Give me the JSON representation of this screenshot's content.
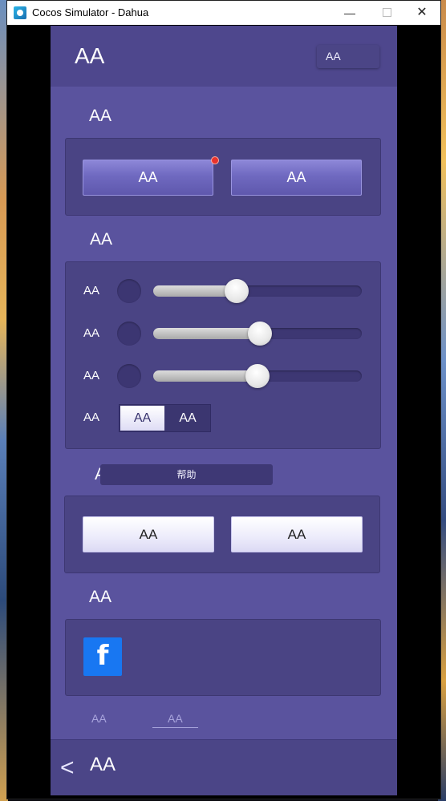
{
  "window": {
    "title": "Cocos Simulator - Dahua",
    "minimize_glyph": "—",
    "close_glyph": "✕"
  },
  "header": {
    "title": "AA",
    "button_label": "AA"
  },
  "sections": {
    "s1": {
      "title": "AA",
      "buttons": [
        "AA",
        "AA"
      ],
      "notification_dot": true
    },
    "s2": {
      "title": "AA",
      "sliders": [
        {
          "label": "AA",
          "value": 0.4
        },
        {
          "label": "AA",
          "value": 0.51
        },
        {
          "label": "AA",
          "value": 0.5
        }
      ],
      "toggle": {
        "label": "AA",
        "options": [
          "AA",
          "AA"
        ],
        "selected_index": 0
      }
    },
    "s3": {
      "title": "AA",
      "tooltip": "帮助",
      "buttons": [
        "AA",
        "AA"
      ]
    },
    "s4": {
      "title": "AA",
      "icon": "facebook-icon",
      "icon_glyph": "f"
    }
  },
  "footer_tabs": [
    "AA",
    "AA"
  ],
  "bottom_bar": {
    "back_glyph": "<",
    "title": "AA"
  },
  "colors": {
    "app_bg": "#5a539e",
    "panel_bg": "#4a4484",
    "bar_bg": "#4b4587",
    "facebook_blue": "#1877f2",
    "notification_red": "#e8322d"
  }
}
